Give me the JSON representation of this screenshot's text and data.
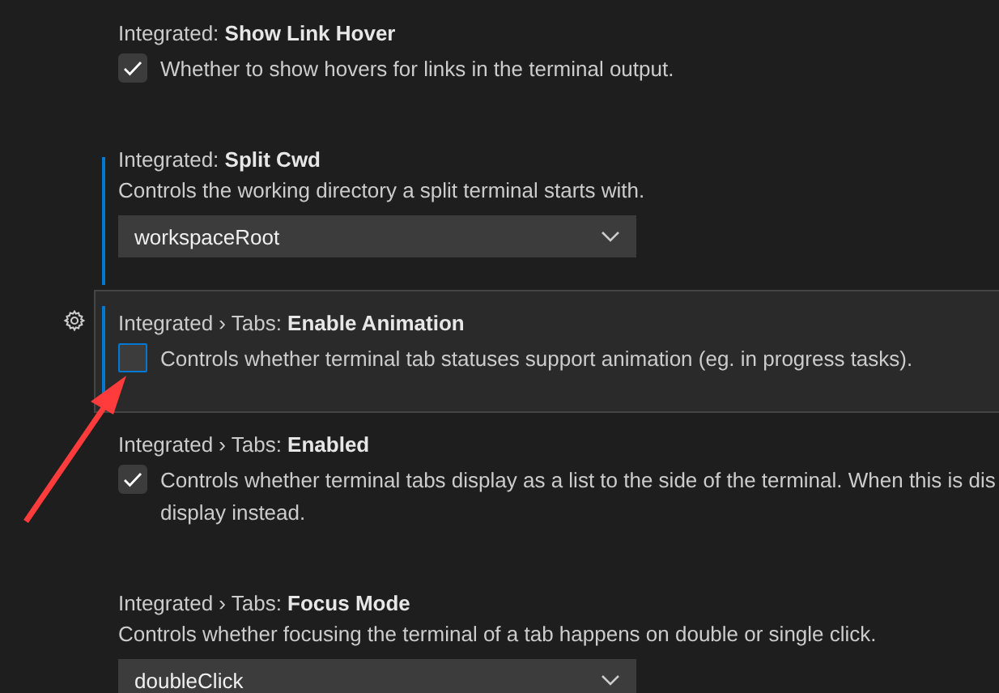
{
  "settings": [
    {
      "kind": "checkbox",
      "category": "Integrated: ",
      "name": "Show Link Hover",
      "lines": [
        "Whether to show hovers for links in the terminal output."
      ],
      "checked": true,
      "focused": false,
      "marked": false
    },
    {
      "kind": "dropdown",
      "category": "Integrated: ",
      "name": "Split Cwd",
      "lines": [
        "Controls the working directory a split terminal starts with."
      ],
      "value": "workspaceRoot",
      "focused": false,
      "marked": true
    },
    {
      "kind": "checkbox",
      "category": "Integrated › Tabs: ",
      "name": "Enable Animation",
      "lines": [
        "Controls whether terminal tab statuses support animation (eg. in progress tasks)."
      ],
      "checked": false,
      "focused": true,
      "marked": true
    },
    {
      "kind": "checkbox",
      "category": "Integrated › Tabs: ",
      "name": "Enabled",
      "lines": [
        "Controls whether terminal tabs display as a list to the side of the terminal. When this is dis",
        "display instead."
      ],
      "checked": true,
      "focused": false,
      "marked": false
    },
    {
      "kind": "dropdown",
      "category": "Integrated › Tabs: ",
      "name": "Focus Mode",
      "lines": [
        "Controls whether focusing the terminal of a tab happens on double or single click."
      ],
      "value": "doubleClick",
      "focused": false,
      "marked": false
    }
  ]
}
